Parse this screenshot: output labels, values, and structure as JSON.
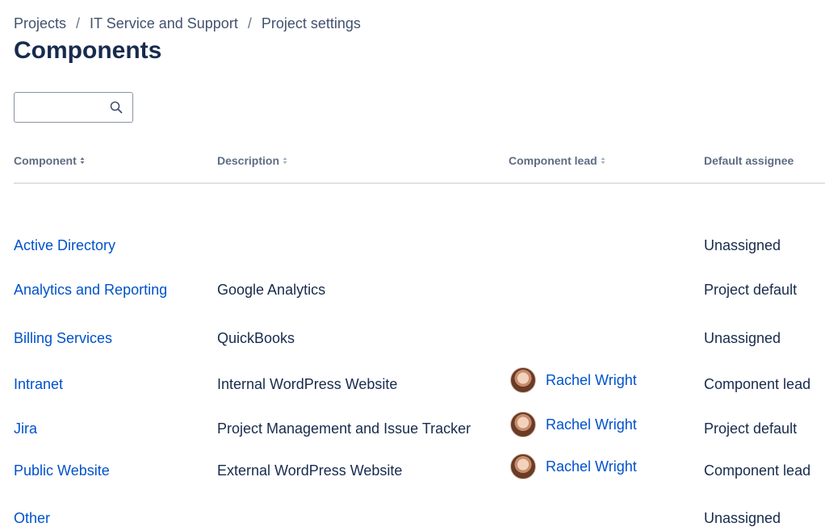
{
  "breadcrumb": {
    "items": [
      "Projects",
      "IT Service and Support",
      "Project settings"
    ],
    "separator": "/"
  },
  "page": {
    "title": "Components"
  },
  "search": {
    "value": "",
    "placeholder": "",
    "icon": "search-icon"
  },
  "table": {
    "columns": [
      {
        "label": "Component",
        "sortable": true
      },
      {
        "label": "Description",
        "sortable": true
      },
      {
        "label": "Component lead",
        "sortable": true
      },
      {
        "label": "Default assignee",
        "sortable": false
      }
    ],
    "rows": [
      {
        "component": "Active Directory",
        "description": "",
        "lead": "",
        "assignee": "Unassigned"
      },
      {
        "component": "Analytics and Reporting",
        "description": "Google Analytics",
        "lead": "",
        "assignee": "Project default"
      },
      {
        "component": "Billing Services",
        "description": "QuickBooks",
        "lead": "",
        "assignee": "Unassigned"
      },
      {
        "component": "Intranet",
        "description": "Internal WordPress Website",
        "lead": "Rachel Wright",
        "assignee": "Component lead"
      },
      {
        "component": "Jira",
        "description": "Project Management and Issue Tracker",
        "lead": "Rachel Wright",
        "assignee": "Project default"
      },
      {
        "component": "Public Website",
        "description": "External WordPress Website",
        "lead": "Rachel Wright",
        "assignee": "Component lead"
      },
      {
        "component": "Other",
        "description": "",
        "lead": "",
        "assignee": "Unassigned"
      }
    ]
  },
  "colors": {
    "link": "#0052cc",
    "text": "#172b4d",
    "header_text": "#5e6c84",
    "divider": "#dfe1e6"
  }
}
